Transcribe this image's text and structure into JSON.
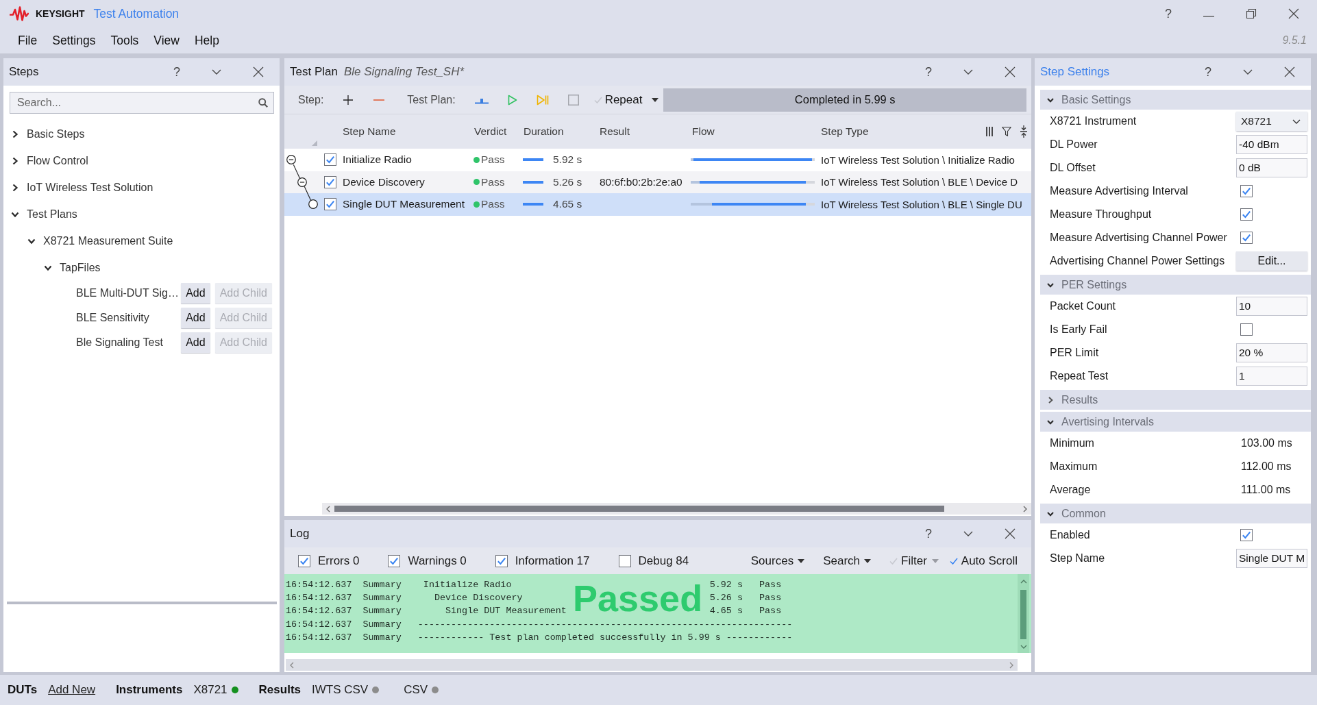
{
  "window": {
    "brand": "KEYSIGHT",
    "title": "Test Automation",
    "help": "?",
    "version": "9.5.1"
  },
  "menu": [
    "File",
    "Settings",
    "Tools",
    "View",
    "Help"
  ],
  "steps_panel": {
    "title": "Steps",
    "active": false,
    "help": "?",
    "search": {
      "placeholder": "Search..."
    },
    "tree": [
      {
        "label": "Basic Steps",
        "expanded": false
      },
      {
        "label": "Flow Control",
        "expanded": false
      },
      {
        "label": "IoT Wireless Test Solution",
        "expanded": false
      },
      {
        "label": "Test Plans",
        "expanded": true,
        "children": [
          {
            "label": "X8721 Measurement Suite",
            "expanded": true,
            "children": [
              {
                "label": "TapFiles",
                "expanded": true,
                "children": [
                  {
                    "label": "BLE Multi-DUT Sig…",
                    "actions": [
                      {
                        "label": "Add",
                        "disabled": false
                      },
                      {
                        "label": "Add Child",
                        "disabled": true
                      }
                    ]
                  },
                  {
                    "label": "BLE Sensitivity",
                    "actions": [
                      {
                        "label": "Add",
                        "disabled": false
                      },
                      {
                        "label": "Add Child",
                        "disabled": true
                      }
                    ]
                  },
                  {
                    "label": "Ble Signaling Test",
                    "actions": [
                      {
                        "label": "Add",
                        "disabled": false
                      },
                      {
                        "label": "Add Child",
                        "disabled": true
                      }
                    ]
                  }
                ]
              }
            ]
          }
        ]
      }
    ]
  },
  "test_plan_panel": {
    "title": "Test Plan",
    "plan_name": "Ble Signaling Test_SH*",
    "active": false,
    "help": "?",
    "toolbar": {
      "step_label": "Step:",
      "plan_label": "Test Plan:",
      "repeat": {
        "label": "Repeat",
        "checked": false
      },
      "status": "Completed in 5.99 s"
    },
    "table": {
      "columns": [
        "Step Name",
        "Verdict",
        "Duration",
        "Result",
        "Flow",
        "Step Type"
      ],
      "rows": [
        {
          "name": "Initialize Radio",
          "checked": true,
          "selected": false,
          "expanded": true,
          "verdict": {
            "text": "Pass",
            "color": "#2fc46a"
          },
          "duration": "5.92 s",
          "flow": {
            "start": {
              "level": 0.02
            },
            "end": {
              "level": 0.98
            }
          },
          "step_type": "IoT Wireless Test Solution \\ Initialize Radio",
          "children": [
            {
              "name": "Device Discovery",
              "checked": true,
              "selected": false,
              "expanded": true,
              "verdict": {
                "text": "Pass",
                "color": "#2fc46a"
              },
              "duration": "5.26 s",
              "result": "80:6f:b0:2b:2e:a0",
              "flow": {
                "start": {
                  "level": 0.07
                },
                "end": {
                  "level": 0.93
                }
              },
              "step_type": "IoT Wireless Test Solution \\ BLE \\ Device D",
              "children": [
                {
                  "name": "Single DUT Measurement",
                  "checked": true,
                  "selected": true,
                  "verdict": {
                    "text": "Pass",
                    "color": "#2fc46a"
                  },
                  "duration": "4.65 s",
                  "flow": {
                    "start": {
                      "level": 0.17
                    },
                    "end": {
                      "level": 0.93
                    }
                  },
                  "step_type": "IoT Wireless Test Solution \\ BLE \\ Single DU"
                }
              ]
            }
          ]
        }
      ]
    }
  },
  "log_panel": {
    "title": "Log",
    "active": false,
    "help": "?",
    "filters": [
      {
        "label": "Errors 0",
        "checked": true
      },
      {
        "label": "Warnings 0",
        "checked": true
      },
      {
        "label": "Information 17",
        "checked": true
      },
      {
        "label": "Debug 84",
        "checked": false
      }
    ],
    "menus": [
      "Sources",
      "Search"
    ],
    "toggles": [
      {
        "kind": "dropdown",
        "label": "Filter",
        "checked": false
      },
      {
        "kind": "plain",
        "label": "Auto Scroll",
        "checked": true
      }
    ],
    "entries": [
      {
        "kind": "step",
        "time": "16:54:12.637",
        "source": "Summary",
        "message": "Initialize Radio",
        "duration": "5.92 s",
        "verdict": "Pass",
        "children": [
          {
            "kind": "step",
            "time": "16:54:12.637",
            "source": "Summary",
            "message": "Device Discovery",
            "duration": "5.26 s",
            "verdict": "Pass",
            "children": [
              {
                "kind": "step",
                "time": "16:54:12.637",
                "source": "Summary",
                "message": "Single DUT Measurement",
                "duration": "4.65 s",
                "verdict": "Pass"
              }
            ]
          }
        ]
      },
      {
        "kind": "rule",
        "time": "16:54:12.637",
        "source": "Summary",
        "message": "--------------------------------------------------------------------"
      },
      {
        "kind": "rule",
        "time": "16:54:12.637",
        "source": "Summary",
        "message": "------------ Test plan completed successfully in 5.99 s ------------"
      }
    ],
    "banner": "Passed"
  },
  "step_settings_panel": {
    "title": "Step Settings",
    "active": true,
    "help": "?",
    "groups": [
      {
        "title": "Basic Settings",
        "expanded": true,
        "rows": [
          {
            "kind": "dropdown",
            "label": "X8721 Instrument",
            "value": "X8721"
          },
          {
            "kind": "field",
            "label": "DL Power",
            "value": "-40 dBm"
          },
          {
            "kind": "field",
            "label": "DL Offset",
            "value": "0 dB"
          },
          {
            "kind": "checkbox",
            "label": "Measure Advertising Interval",
            "checked": true
          },
          {
            "kind": "checkbox",
            "label": "Measure Throughput",
            "checked": true
          },
          {
            "kind": "checkbox",
            "label": "Measure Advertising Channel Power",
            "checked": true
          },
          {
            "kind": "button",
            "label": "Advertising Channel Power Settings",
            "value": "Edit..."
          }
        ]
      },
      {
        "title": "PER Settings",
        "expanded": true,
        "rows": [
          {
            "kind": "field",
            "label": "Packet Count",
            "value": "10"
          },
          {
            "kind": "checkbox",
            "label": "Is Early Fail",
            "checked": false
          },
          {
            "kind": "field",
            "label": "PER Limit",
            "value": "20 %"
          },
          {
            "kind": "field",
            "label": "Repeat Test",
            "value": "1"
          }
        ]
      },
      {
        "title": "Results",
        "expanded": false
      },
      {
        "title": "Avertising Intervals",
        "expanded": true,
        "rows": [
          {
            "kind": "readout",
            "label": "Minimum",
            "value": "103.00 ms"
          },
          {
            "kind": "readout",
            "label": "Maximum",
            "value": "112.00 ms"
          },
          {
            "kind": "readout",
            "label": "Average",
            "value": "111.00 ms"
          }
        ]
      },
      {
        "title": "Common",
        "expanded": true,
        "rows": [
          {
            "kind": "checkbox",
            "label": "Enabled",
            "checked": true
          },
          {
            "kind": "field",
            "label": "Step Name",
            "value": "Single DUT M"
          }
        ]
      }
    ]
  },
  "status_bar": {
    "groups": [
      {
        "heading": "DUTs",
        "items": [
          {
            "kind": "link",
            "label": "Add New"
          }
        ]
      },
      {
        "heading": "Instruments",
        "items": [
          {
            "kind": "status",
            "label": "X8721",
            "color": "#14901f"
          }
        ]
      },
      {
        "heading": "Results",
        "items": [
          {
            "kind": "status",
            "label": "IWTS CSV",
            "color": "#8c8c8c"
          },
          {
            "kind": "status",
            "label": "CSV",
            "color": "#8c8c8c"
          }
        ]
      }
    ]
  }
}
